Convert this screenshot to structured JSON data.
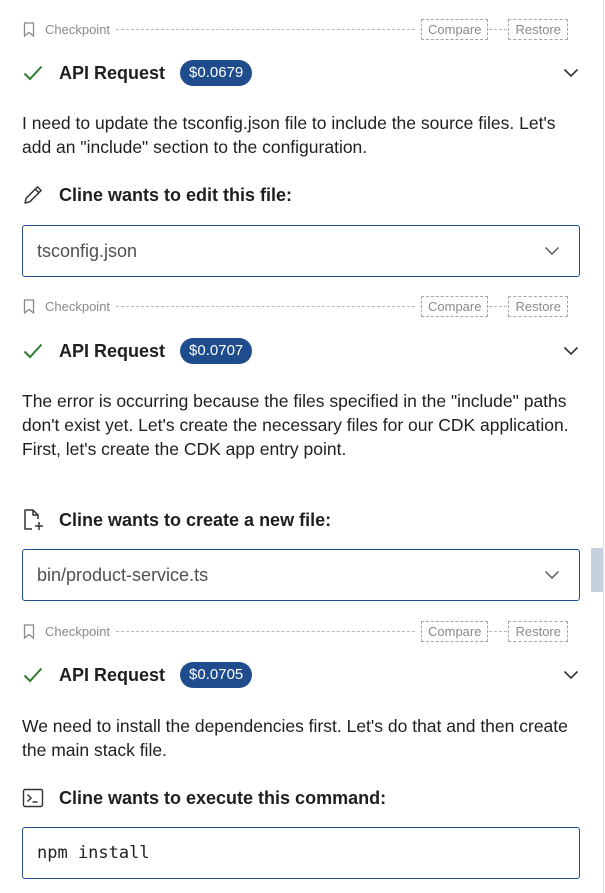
{
  "checkpoint": {
    "label": "Checkpoint",
    "compare_label": "Compare",
    "restore_label": "Restore"
  },
  "messages": [
    {
      "api_title": "API Request",
      "cost": "$0.0679",
      "text": "I need to update the tsconfig.json file to include the source files. Let's add an \"include\" section to the configuration.",
      "tool_title": "Cline wants to edit this file:",
      "tool_icon": "pencil-icon",
      "file": "tsconfig.json"
    },
    {
      "api_title": "API Request",
      "cost": "$0.0707",
      "text": "The error is occurring because the files specified in the \"include\" paths don't exist yet. Let's create the necessary files for our CDK application. First, let's create the CDK app entry point.",
      "tool_title": "Cline wants to create a new file:",
      "tool_icon": "new-file-icon",
      "file": "bin/product-service.ts"
    },
    {
      "api_title": "API Request",
      "cost": "$0.0705",
      "text": "We need to install the dependencies first. Let's do that and then create the main stack file.",
      "tool_title": "Cline wants to execute this command:",
      "tool_icon": "terminal-icon",
      "command": "npm install"
    }
  ],
  "colors": {
    "accent": "#1e4c8c",
    "check": "#2e7d32",
    "muted": "#8a8a8a"
  }
}
